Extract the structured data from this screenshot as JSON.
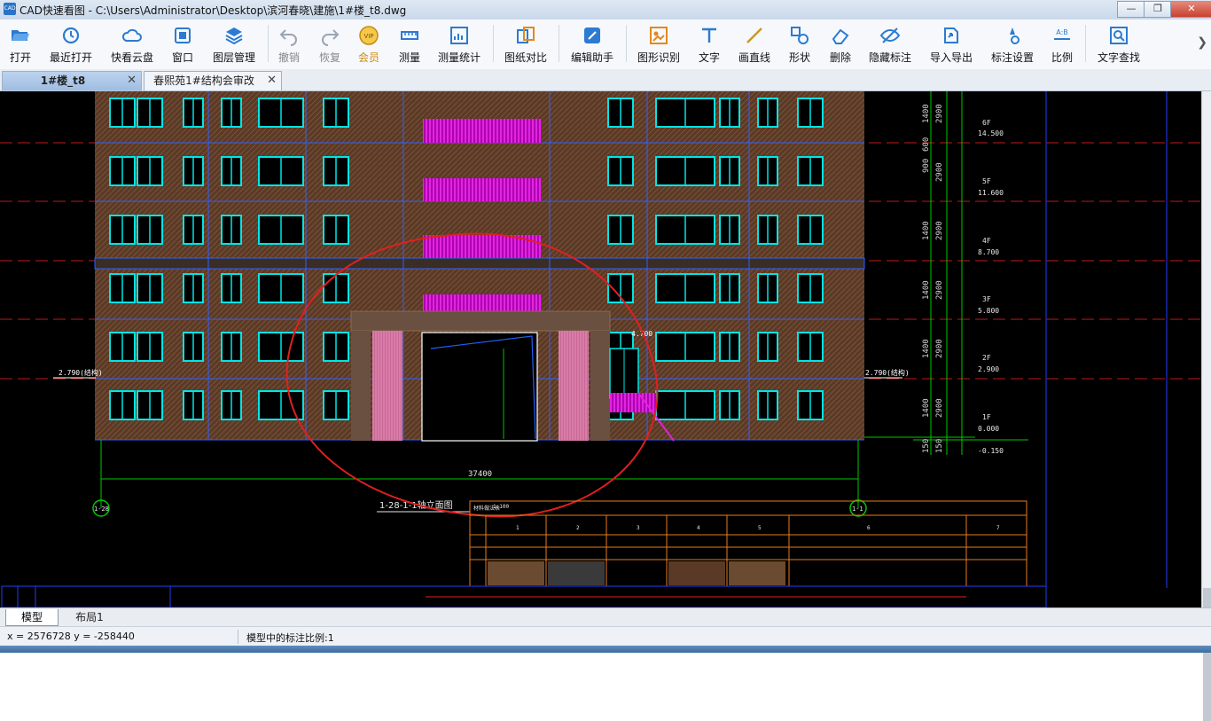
{
  "window": {
    "title": "CAD快速看图 - C:\\Users\\Administrator\\Desktop\\滨河春晓\\建施\\1#楼_t8.dwg",
    "app_icon_text": "CAD",
    "minimize": "—",
    "maximize": "❐",
    "close": "✕"
  },
  "toolbar": {
    "items": [
      {
        "label": "打开",
        "icon": "folder-open-icon"
      },
      {
        "label": "最近打开",
        "icon": "history-icon"
      },
      {
        "label": "快看云盘",
        "icon": "cloud-icon"
      },
      {
        "label": "窗口",
        "icon": "window-icon"
      },
      {
        "label": "图层管理",
        "icon": "layers-icon"
      },
      {
        "label": "撤销",
        "icon": "undo-icon"
      },
      {
        "label": "恢复",
        "icon": "redo-icon"
      },
      {
        "label": "会员",
        "icon": "vip-icon",
        "badge": "VIP"
      },
      {
        "label": "测量",
        "icon": "ruler-icon"
      },
      {
        "label": "测量统计",
        "icon": "measure-stats-icon"
      },
      {
        "label": "图纸对比",
        "icon": "compare-icon"
      },
      {
        "label": "编辑助手",
        "icon": "edit-assistant-icon"
      },
      {
        "label": "图形识别",
        "icon": "shape-recognize-icon"
      },
      {
        "label": "文字",
        "icon": "text-icon"
      },
      {
        "label": "画直线",
        "icon": "line-icon"
      },
      {
        "label": "形状",
        "icon": "shapes-icon"
      },
      {
        "label": "删除",
        "icon": "eraser-icon"
      },
      {
        "label": "隐藏标注",
        "icon": "hide-annotation-icon"
      },
      {
        "label": "导入导出",
        "icon": "import-export-icon"
      },
      {
        "label": "标注设置",
        "icon": "annotation-settings-icon"
      },
      {
        "label": "比例",
        "icon": "scale-icon",
        "badge": "A:B"
      },
      {
        "label": "文字查找",
        "icon": "text-search-icon"
      }
    ],
    "more": "❯",
    "accent_color": "#1f6fc5"
  },
  "tabs": [
    {
      "label": "1#楼_t8",
      "close": "✕",
      "active": true
    },
    {
      "label": "春熙苑1#结构会审改",
      "close": "✕",
      "active": false
    }
  ],
  "drawing": {
    "dim_levels": [
      {
        "floor": "6F",
        "elev": "14.500"
      },
      {
        "floor": "5F",
        "elev": "11.600"
      },
      {
        "floor": "4F",
        "elev": "8.700"
      },
      {
        "floor": "3F",
        "elev": "5.800"
      },
      {
        "floor": "2F",
        "elev": "2.900"
      },
      {
        "floor": "1F",
        "elev": "0.000"
      },
      {
        "floor": "",
        "elev": "-0.150"
      }
    ],
    "left_level": "2.790(结构)",
    "right_level": "2.790(结构)",
    "mid_level": "4.700",
    "floor_dim": "2900",
    "side_dims": [
      "1400",
      "600",
      "900"
    ],
    "bottom_dims": [
      "150",
      "150"
    ],
    "overall_dim": "37400",
    "axis_left": "1-28",
    "axis_right": "1-1",
    "drawing_title": "1-28-1-1轴立面图",
    "table_header": "材料做法表",
    "table_scale": "1:100",
    "table_cols": [
      "1",
      "2",
      "3",
      "4",
      "5",
      "6",
      "7"
    ],
    "colors": {
      "background": "#000000",
      "window": "#00e5e5",
      "balcony": "#e020e0",
      "wall_fill": "#5a3a26",
      "red_annotation": "#e02020",
      "green": "#00c800",
      "table_border": "#e87d1a"
    }
  },
  "layout_tabs": {
    "model": "模型",
    "layout": "布局1"
  },
  "status": {
    "coords": "x = 2576728  y = -258440",
    "scale_text": "模型中的标注比例:1"
  }
}
